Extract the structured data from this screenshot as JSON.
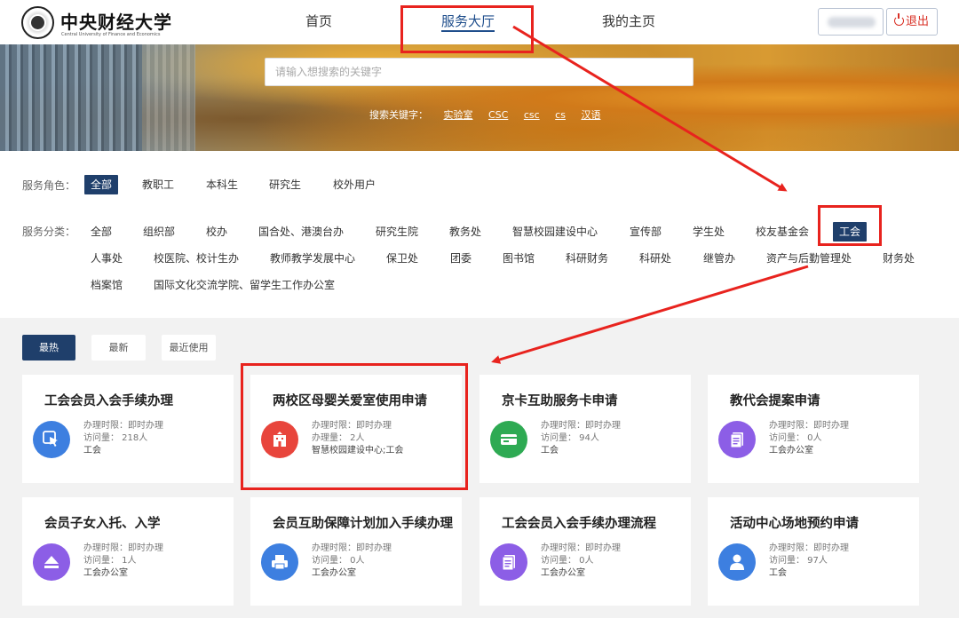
{
  "header": {
    "logo_cn": "中央财经大学",
    "logo_en": "Central University of Finance and Economics",
    "nav": {
      "home": "首页",
      "hall": "服务大厅",
      "mine": "我的主页"
    },
    "logout": "退出"
  },
  "banner": {
    "search_placeholder": "请输入想搜索的关键字",
    "hot_label": "搜索关键字：",
    "hot_keywords": [
      "实验室",
      "CSC",
      "csc",
      "cs",
      "汉语"
    ]
  },
  "filters": {
    "role_label": "服务角色：",
    "roles": [
      "全部",
      "教职工",
      "本科生",
      "研究生",
      "校外用户"
    ],
    "category_label": "服务分类：",
    "categories_row1": [
      "全部",
      "组织部",
      "校办",
      "国合处、港澳台办",
      "研究生院",
      "教务处",
      "智慧校园建设中心",
      "宣传部",
      "学生处",
      "校友基金会",
      "工会"
    ],
    "categories_row2": [
      "人事处",
      "校医院、校计生办",
      "教师教学发展中心",
      "保卫处",
      "团委",
      "图书馆",
      "科研财务",
      "科研处",
      "继管办",
      "资产与后勤管理处",
      "财务处"
    ],
    "categories_row3": [
      "档案馆",
      "国际文化交流学院、留学生工作办公室"
    ]
  },
  "tabs": [
    "最热",
    "最新",
    "最近使用"
  ],
  "cards": [
    {
      "title": "工会会员入会手续办理",
      "line1": "办理时限：即时办理",
      "line2": "访问量： 218人",
      "dept": "工会",
      "color": "#3d7fe0",
      "icon": "cursor-click-icon"
    },
    {
      "title": "两校区母婴关爱室使用申请",
      "line1": "办理时限：即时办理",
      "line2": "办理量： 2人",
      "dept": "智慧校园建设中心;工会",
      "color": "#e8453c",
      "icon": "building-icon"
    },
    {
      "title": "京卡互助服务卡申请",
      "line1": "办理时限：即时办理",
      "line2": "访问量： 94人",
      "dept": "工会",
      "color": "#2eaa53",
      "icon": "card-icon"
    },
    {
      "title": "教代会提案申请",
      "line1": "办理时限：即时办理",
      "line2": "访问量： 0人",
      "dept": "工会办公室",
      "color": "#8c5ee6",
      "icon": "document-icon"
    },
    {
      "title": "会员子女入托、入学",
      "line1": "办理时限：即时办理",
      "line2": "访问量： 1人",
      "dept": "工会办公室",
      "color": "#8c5ee6",
      "icon": "eject-icon"
    },
    {
      "title": "会员互助保障计划加入手续办理",
      "line1": "办理时限：即时办理",
      "line2": "访问量： 0人",
      "dept": "工会办公室",
      "color": "#3d7fe0",
      "icon": "printer-icon"
    },
    {
      "title": "工会会员入会手续办理流程",
      "line1": "办理时限：即时办理",
      "line2": "访问量： 0人",
      "dept": "工会办公室",
      "color": "#8c5ee6",
      "icon": "document-icon"
    },
    {
      "title": "活动中心场地预约申请",
      "line1": "办理时限：即时办理",
      "line2": "访问量： 97人",
      "dept": "工会",
      "color": "#3d7fe0",
      "icon": "user-icon"
    }
  ]
}
